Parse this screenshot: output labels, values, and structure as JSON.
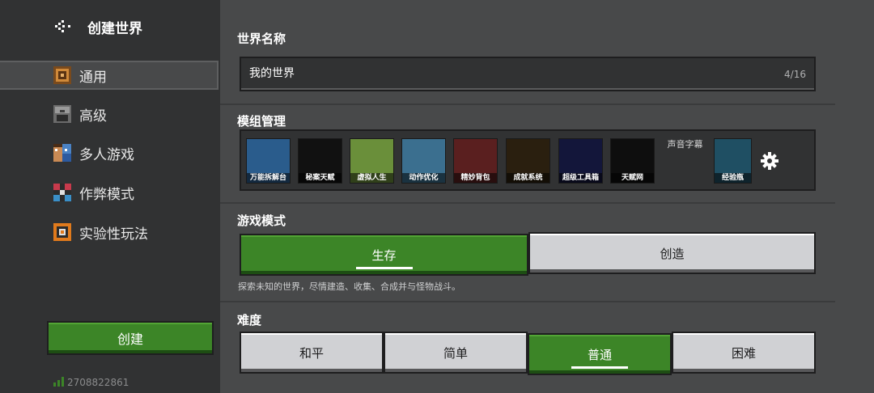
{
  "sidebar": {
    "title": "创建世界",
    "items": [
      {
        "label": "通用",
        "icon": "general-icon",
        "active": true
      },
      {
        "label": "高级",
        "icon": "advanced-icon",
        "active": false
      },
      {
        "label": "多人游戏",
        "icon": "multiplayer-icon",
        "active": false
      },
      {
        "label": "作弊模式",
        "icon": "cheats-icon",
        "active": false
      },
      {
        "label": "实验性玩法",
        "icon": "experiments-icon",
        "active": false
      }
    ],
    "create_label": "创建",
    "build_id": "2708822861"
  },
  "world_name": {
    "title": "世界名称",
    "value": "我的世界",
    "count": "4/16"
  },
  "mods": {
    "title": "模组管理",
    "items": [
      {
        "label": "万能拆解台",
        "color": "#2a5c8c"
      },
      {
        "label": "秘案天赋",
        "color": "#111111"
      },
      {
        "label": "虚拟人生",
        "color": "#6a8f3a"
      },
      {
        "label": "动作优化",
        "color": "#3b6f8f"
      },
      {
        "label": "精妙背包",
        "color": "#5a1f1f"
      },
      {
        "label": "成就系统",
        "color": "#2a1f0f"
      },
      {
        "label": "超级工具箱",
        "color": "#13163a"
      },
      {
        "label": "天赋网",
        "color": "#0e0e0e"
      },
      {
        "label": "声音字幕",
        "color": "#313233"
      },
      {
        "label": "经验瓶",
        "color": "#1f4f63"
      }
    ]
  },
  "game_mode": {
    "title": "游戏模式",
    "options": [
      "生存",
      "创造"
    ],
    "selected": "生存",
    "description": "探索未知的世界，尽情建造、收集、合成并与怪物战斗。"
  },
  "difficulty": {
    "title": "难度",
    "options": [
      "和平",
      "简单",
      "普通",
      "困难"
    ],
    "selected": "普通"
  },
  "colors": {
    "accent_green": "#3c8527",
    "panel_dark": "#313233",
    "background": "#48494a",
    "button_light": "#d0d1d4"
  }
}
